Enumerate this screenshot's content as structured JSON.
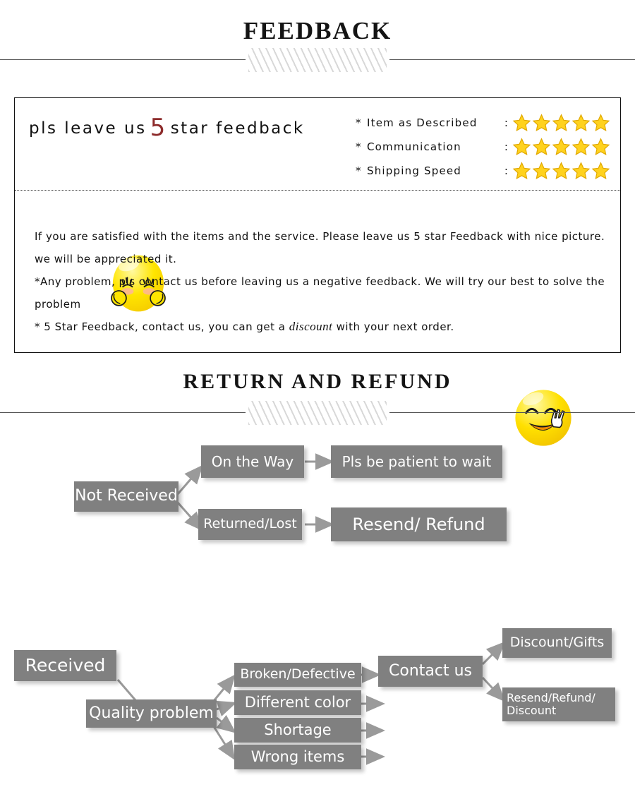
{
  "sections": {
    "feedback_title": "FEEDBACK",
    "return_title": "RETURN  AND  REFUND"
  },
  "feedback": {
    "headline_prefix": "pls leave us",
    "headline_number": "5",
    "headline_suffix": "star feedback",
    "ratings": [
      {
        "asterisk": "*",
        "label": "Item as Described",
        "colon": ":",
        "stars": 5
      },
      {
        "asterisk": "*",
        "label": "Communication",
        "colon": ":",
        "stars": 5
      },
      {
        "asterisk": "*",
        "label": "Shipping Speed",
        "colon": ":",
        "stars": 5
      }
    ],
    "body_lines": [
      "If you are satisfied with the items and the service. Please leave us 5 star Feedback with nice picture. we will be appreciated it.",
      "*Any problem, pls contact us before leaving us a negative feedback. We will try our best to solve  the problem",
      "* 5 Star Feedback, contact us, you can get a discount with your next order."
    ],
    "body_part_a": "If you are satisfied with the items and the service. Please leave us 5 star Feedback with nice picture. we will be appreciated it.",
    "body_part_b": "*Any problem, pls contact us before leaving us a negative feedback. We will try our best to solve  the problem",
    "body_part_c1": "* 5 Star Feedback, contact us, you can get a ",
    "body_part_c_italic": "discount",
    "body_part_c2": " with your next order.",
    "emoji_shy_name": "shy-smiley-emoji",
    "emoji_peace_name": "peace-sign-smiley-emoji"
  },
  "flow_not_received": {
    "nodes": {
      "root": "Not Received",
      "on_the_way": "On the Way",
      "pls_wait": "Pls be patient to wait",
      "returned_lost": "Returned/Lost",
      "resend_refund": "Resend/ Refund"
    }
  },
  "flow_received": {
    "nodes": {
      "root": "Received",
      "quality_problem": "Quality problem",
      "broken": "Broken/Defective",
      "different_color": "Different color",
      "shortage": "Shortage",
      "wrong_items": "Wrong items",
      "contact_us": "Contact us",
      "discount_gifts": "Discount/Gifts",
      "resend_refund_discount": "Resend/Refund/\nDiscount"
    }
  },
  "colors": {
    "box_gray": "#808080",
    "box_text": "#ffffff",
    "arrow_gray": "#9a9a9a",
    "star_gold": "#ffd21e",
    "star_outline": "#e0a800",
    "accent_red": "#8d2b2b",
    "emoji_yellow": "#ffe200",
    "rule_gray": "#555555",
    "hatch_gray": "#d8d8d8"
  }
}
